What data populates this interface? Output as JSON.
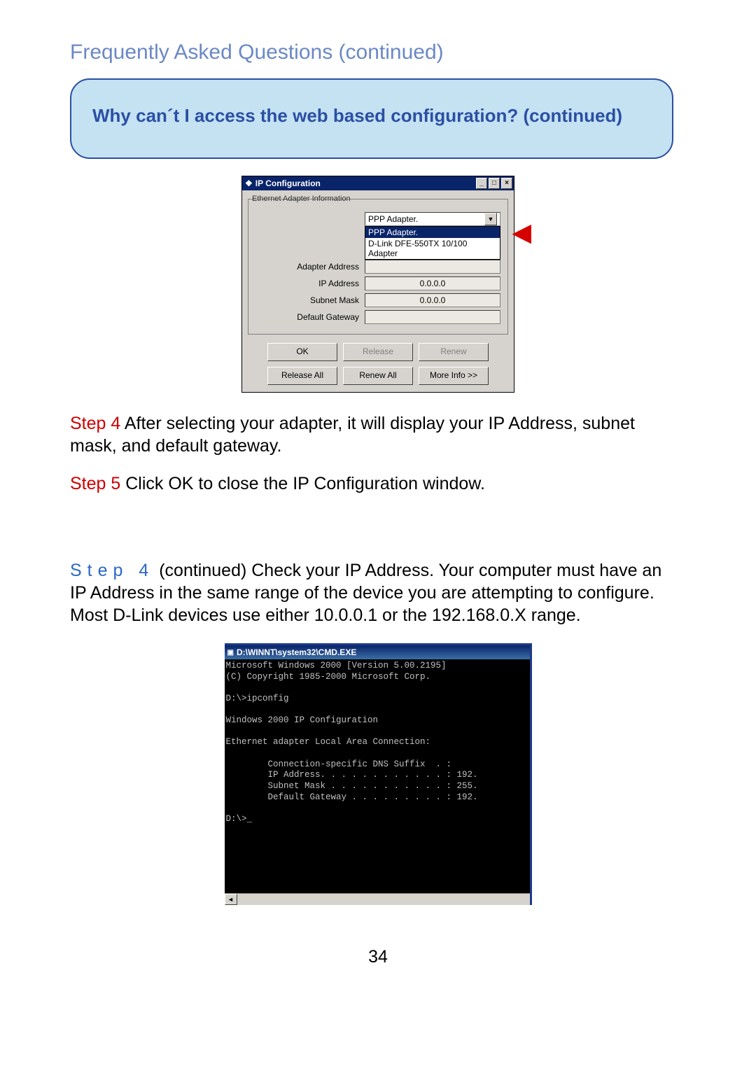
{
  "page_title": "Frequently Asked Questions (continued)",
  "callout_title": "Why can´t I access the web based configuration? (continued)",
  "ipcfg": {
    "window_title": "IP Configuration",
    "group_label": "Ethernet Adapter Information",
    "selected_adapter": "PPP Adapter.",
    "dropdown": {
      "opt_selected": "PPP Adapter.",
      "opt_other": "D-Link DFE-550TX 10/100 Adapter"
    },
    "rows": {
      "adapter_address": {
        "label": "Adapter Address",
        "value": ""
      },
      "ip_address": {
        "label": "IP Address",
        "value": "0.0.0.0"
      },
      "subnet_mask": {
        "label": "Subnet Mask",
        "value": "0.0.0.0"
      },
      "default_gateway": {
        "label": "Default Gateway",
        "value": ""
      }
    },
    "buttons": {
      "ok": "OK",
      "release": "Release",
      "renew": "Renew",
      "release_all": "Release All",
      "renew_all": "Renew All",
      "more_info": "More Info >>"
    }
  },
  "para1_step": "Step 4 ",
  "para1_rest": "After selecting your adapter, it will display your IP Address, subnet mask, and default gateway.",
  "para2_step": "Step 5 ",
  "para2_rest": "Click OK to close the IP Configuration window.",
  "para3_step": "Step 4",
  "para3_cont": " (continued) ",
  "para3_rest": "Check your IP Address. Your computer must have an IP Address in the same range of the device you are attempting to configure. Most D-Link devices use either 10.0.0.1 or the 192.168.0.X range.",
  "cmd": {
    "title": "D:\\WINNT\\system32\\CMD.EXE",
    "body": "Microsoft Windows 2000 [Version 5.00.2195]\n(C) Copyright 1985-2000 Microsoft Corp.\n\nD:\\>ipconfig\n\nWindows 2000 IP Configuration\n\nEthernet adapter Local Area Connection:\n\n        Connection-specific DNS Suffix  . :\n        IP Address. . . . . . . . . . . . : 192.\n        Subnet Mask . . . . . . . . . . . : 255.\n        Default Gateway . . . . . . . . . : 192.\n\nD:\\>_"
  },
  "page_number": "34"
}
